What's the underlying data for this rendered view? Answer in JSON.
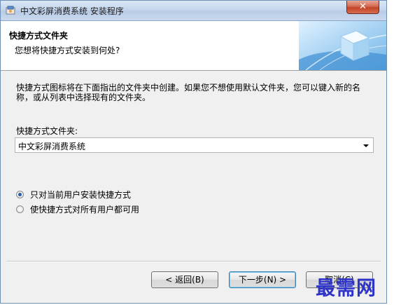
{
  "window": {
    "title": "中文彩屏消费系统 安装程序",
    "close_label": "✕"
  },
  "header": {
    "title": "快捷方式文件夹",
    "subtitle": "您想将快捷方式安装到何处?"
  },
  "content": {
    "description": "快捷方式图标将在下面指出的文件夹中创建。如果您不想使用默认文件夹，您可以键入新的名称，或从列表中选择现有的文件夹。",
    "folder_label": "快捷方式文件夹:",
    "folder_value": "中文彩屏消费系统",
    "radio_options": [
      {
        "label": "只对当前用户安装快捷方式",
        "checked": true
      },
      {
        "label": "使快捷方式对所有用户都可用",
        "checked": false
      }
    ]
  },
  "buttons": {
    "back": "< 返回(B)",
    "next": "下一步(N) >",
    "cancel": "取消(C)"
  },
  "watermark": "最需网"
}
